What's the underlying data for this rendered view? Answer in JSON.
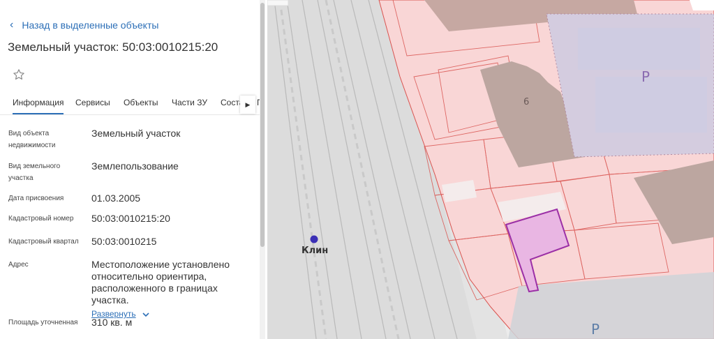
{
  "panel": {
    "back_label": "Назад в выделенные объекты",
    "title": "Земельный участок: 50:03:0010215:20",
    "tabs": [
      "Информация",
      "Сервисы",
      "Объекты",
      "Части ЗУ",
      "Соста",
      "П"
    ],
    "active_tab": "Информация",
    "fields": [
      {
        "label": "Вид объекта недвижимости",
        "value": "Земельный участок"
      },
      {
        "label": "Вид земельного участка",
        "value": "Землепользование"
      },
      {
        "label": "Дата присвоения",
        "value": "01.03.2005"
      },
      {
        "label": "Кадастровый номер",
        "value": "50:03:0010215:20"
      },
      {
        "label": "Кадастровый квартал",
        "value": "50:03:0010215"
      },
      {
        "label": "Адрес",
        "value": "Местоположение установлено относительно ориентира, расположенного в границах участка."
      },
      {
        "label": "Площадь уточненная",
        "value": "310 кв. м"
      }
    ],
    "expand_label": "Развернуть"
  },
  "map": {
    "station_label": "Клин",
    "building_number": "6",
    "parking_label_1": "P",
    "parking_label_2": "P"
  },
  "colors": {
    "accent": "#2c6fb7",
    "parcel_fill": "#f9d6d6",
    "parcel_stroke": "#d9534f",
    "selected_fill": "#e9b6e3",
    "selected_stroke": "#9b2fa6",
    "station_dot": "#3b2fb5"
  }
}
